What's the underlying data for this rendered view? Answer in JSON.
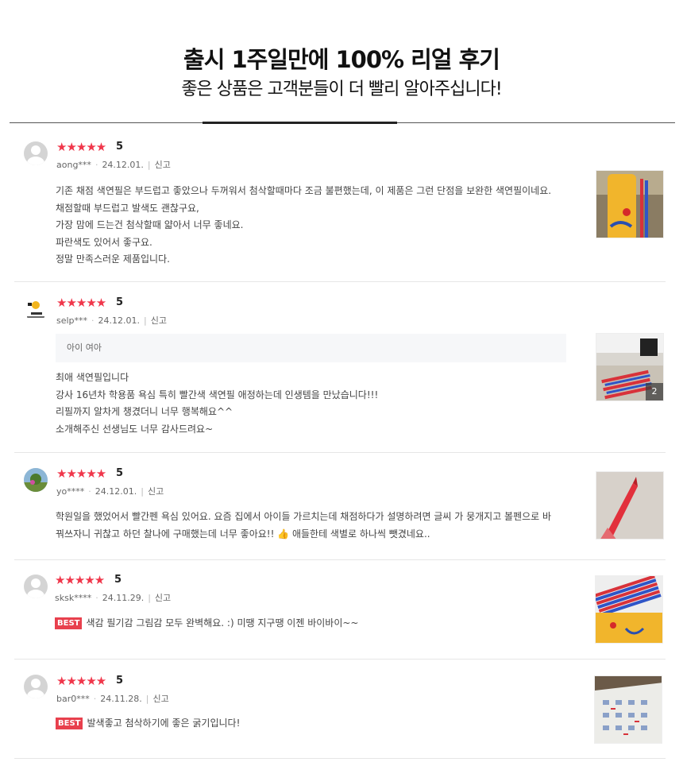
{
  "header": {
    "title": "출시 1주일만에 100% 리얼 후기",
    "subtitle": "좋은 상품은 고객분들이 더 빨리 알아주십니다!"
  },
  "colors": {
    "star": "#f0374b",
    "best_badge": "#e8404d"
  },
  "reviews": [
    {
      "stars": "★★★★★",
      "score": "5",
      "user": "aong***",
      "date": "24.12.01.",
      "report": "신고",
      "lines": [
        "기존 채점 색연필은 부드럽고 좋았으나 두꺼워서 첨삭할때마다 조금 불편했는데, 이 제품은 그런 단점을 보완한 색연필이네요.",
        "채점할때 부드럽고 발색도 괜찮구요,",
        "가장 맘에 드는건 첨삭할때 얇아서 너무 좋네요.",
        "파란색도 있어서 좋구요.",
        "정말 만족스러운 제품입니다."
      ]
    },
    {
      "stars": "★★★★★",
      "score": "5",
      "user": "selp***",
      "date": "24.12.01.",
      "report": "신고",
      "quote": "아이 여아",
      "photo_count": "2",
      "lines": [
        "최애 색연필입니다",
        "강사 16년차 학용품 욕심 특히 빨간색 색연필 애정하는데 인생템을 만났습니다!!!",
        "리필까지 알차게 챙겼더니 너무 행복해요^^",
        "소개해주신 선생님도 너무 감사드려요~"
      ]
    },
    {
      "stars": "★★★★★",
      "score": "5",
      "user": "yo****",
      "date": "24.12.01.",
      "report": "신고",
      "lines": [
        "학원일을 했었어서 빨간펜 욕심 있어요. 요즘 집에서 아이들 가르치는데 채점하다가 설명하려면 글씨 가 뭉개지고 볼펜으로 바",
        "꿔쓰자니 귀찮고 하던 찰나에 구매했는데 너무 좋아요!! 👍 애들한테 색별로 하나씩 뺏겼네요.."
      ]
    },
    {
      "stars": "★★★★★",
      "score": "5",
      "user": "sksk****",
      "date": "24.11.29.",
      "report": "신고",
      "best": "BEST",
      "text": "색감 필기감 그림감 모두 완벽해요. :) 미땡 지구땡 이젠 바이바이~~"
    },
    {
      "stars": "★★★★★",
      "score": "5",
      "user": "bar0***",
      "date": "24.11.28.",
      "report": "신고",
      "best": "BEST",
      "text": "발색좋고 첨삭하기에 좋은 굵기입니다!"
    }
  ]
}
